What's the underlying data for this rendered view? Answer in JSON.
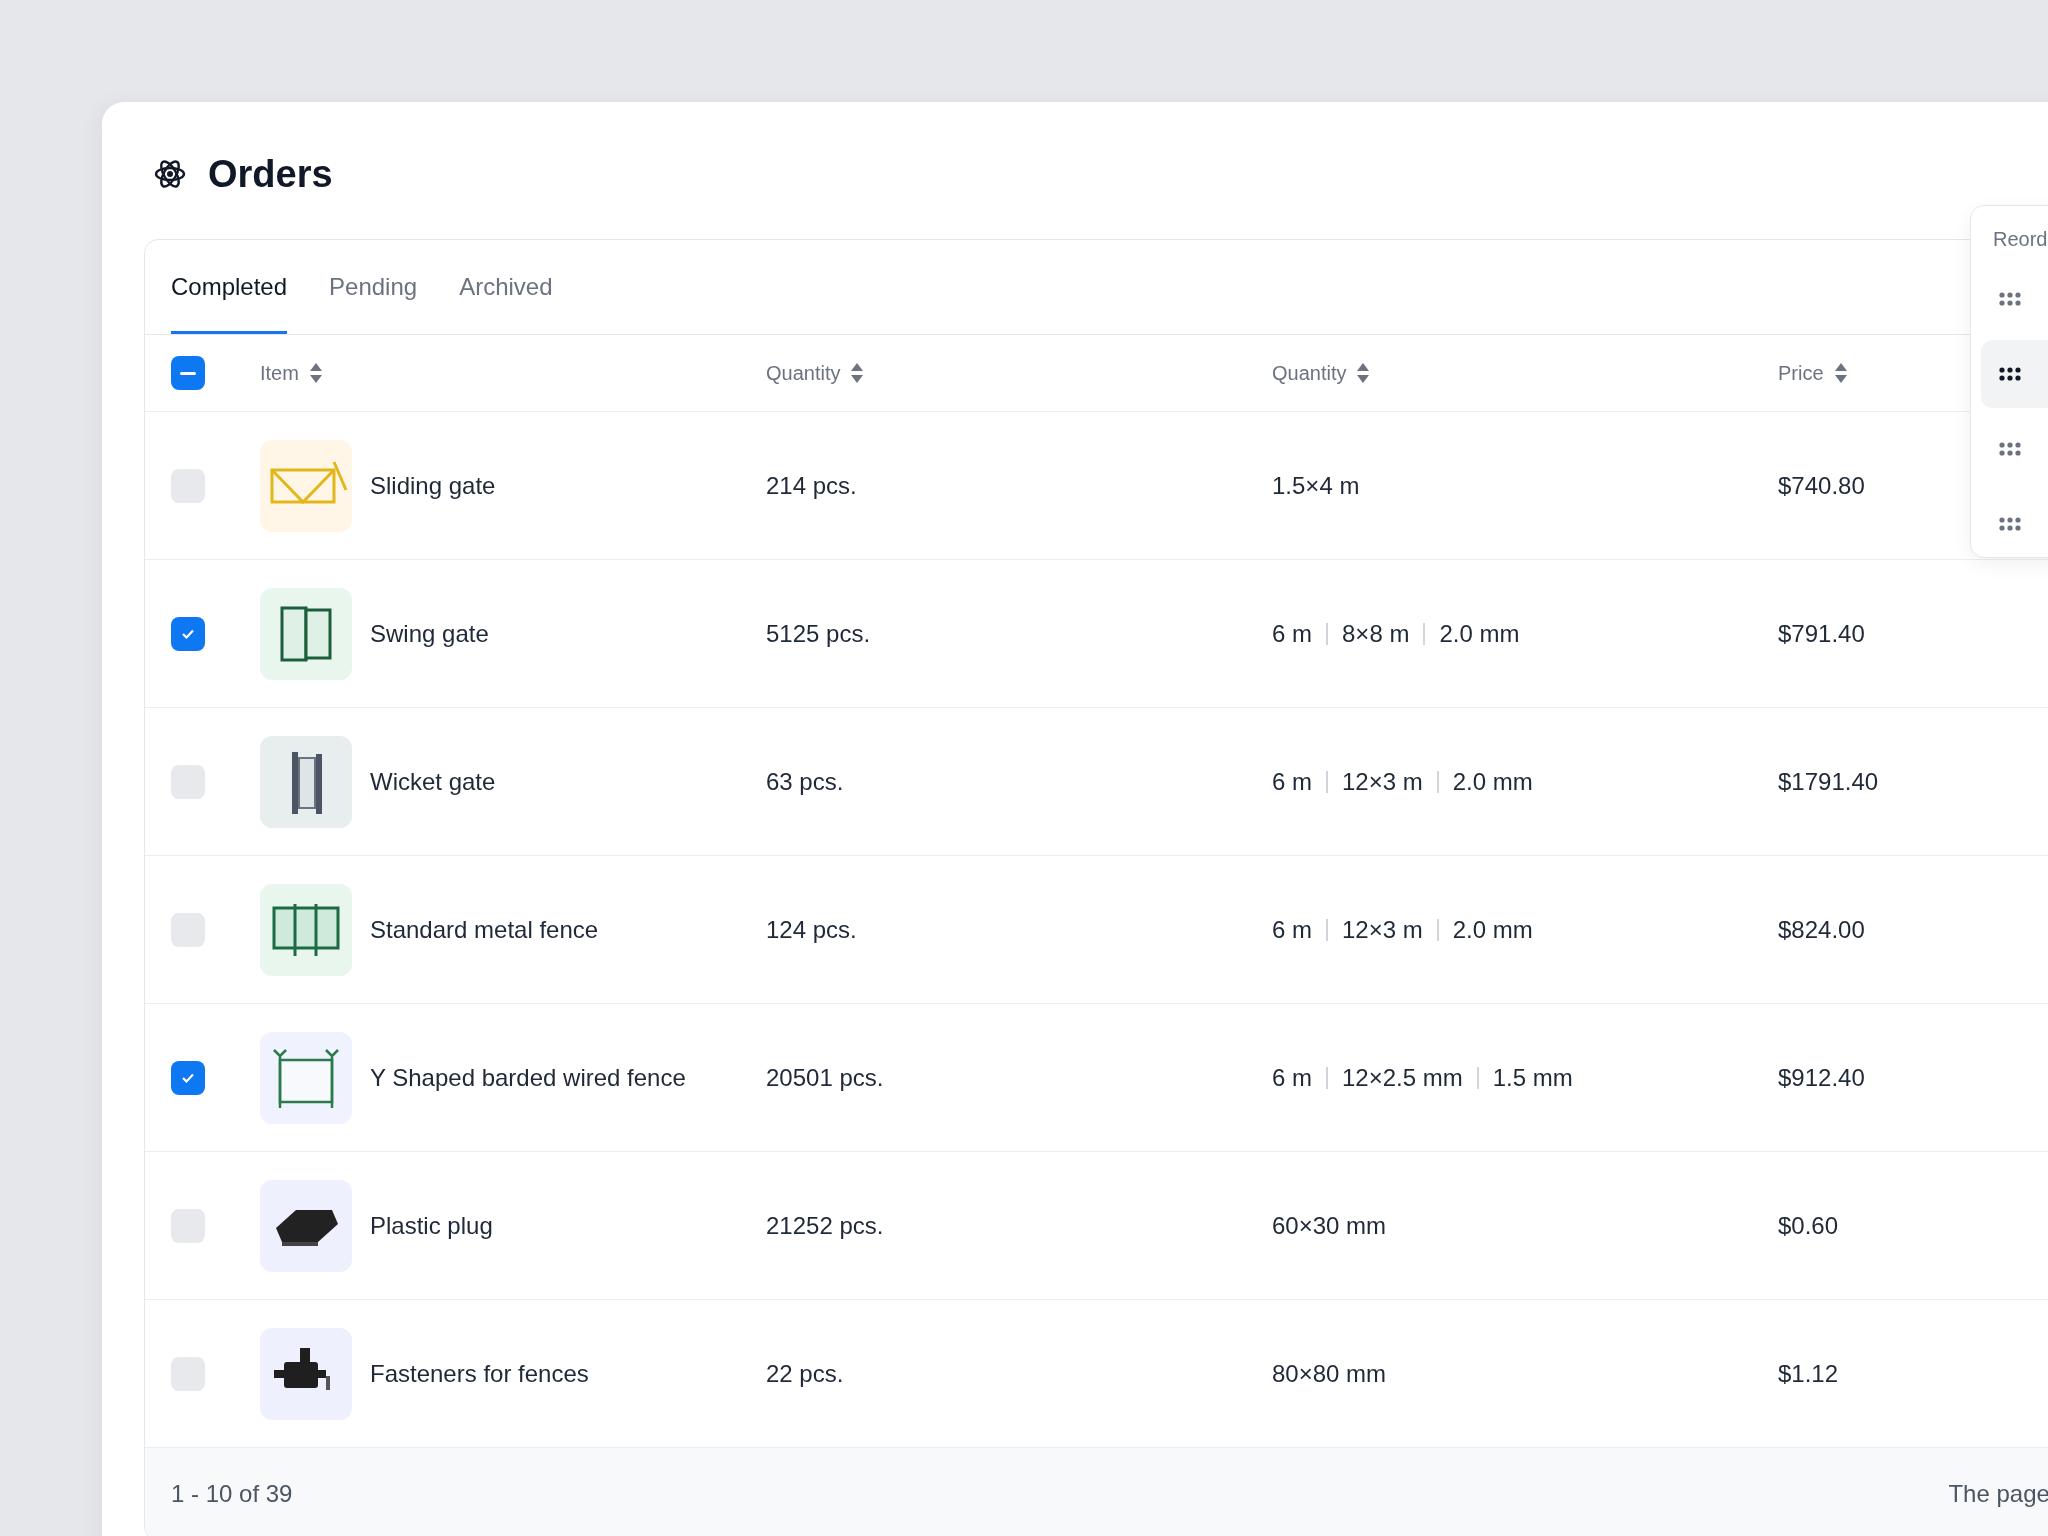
{
  "page": {
    "title": "Orders"
  },
  "tabs": [
    {
      "label": "Completed",
      "selected": true
    },
    {
      "label": "Pending",
      "selected": false
    },
    {
      "label": "Archived",
      "selected": false
    }
  ],
  "table": {
    "select_all": {
      "checked": true,
      "indeterminate": true
    },
    "columns": [
      {
        "label": "Item"
      },
      {
        "label": "Quantity"
      },
      {
        "label": "Quantity"
      },
      {
        "label": "Price"
      }
    ],
    "rows": [
      {
        "checked": false,
        "item": "Sliding gate",
        "quantity": "214 pcs.",
        "size": [
          "1.5×4 m"
        ],
        "price": "$740.80"
      },
      {
        "checked": true,
        "item": "Swing gate",
        "quantity": "5125 pcs.",
        "size": [
          "6 m",
          "8×8 m",
          "2.0 mm"
        ],
        "price": "$791.40"
      },
      {
        "checked": false,
        "item": "Wicket gate",
        "quantity": "63 pcs.",
        "size": [
          "6 m",
          "12×3 m",
          "2.0 mm"
        ],
        "price": "$1791.40"
      },
      {
        "checked": false,
        "item": "Standard metal fence",
        "quantity": "124 pcs.",
        "size": [
          "6 m",
          "12×3 m",
          "2.0 mm"
        ],
        "price": "$824.00"
      },
      {
        "checked": true,
        "item": "Y Shaped barded wired fence",
        "quantity": "20501 pcs.",
        "size": [
          "6 m",
          "12×2.5 mm",
          "1.5 mm"
        ],
        "price": "$912.40"
      },
      {
        "checked": false,
        "item": "Plastic plug",
        "quantity": "21252 pcs.",
        "size": [
          "60×30 mm"
        ],
        "price": "$0.60"
      },
      {
        "checked": false,
        "item": "Fasteners for fences",
        "quantity": "22 pcs.",
        "size": [
          "80×80 mm"
        ],
        "price": "$1.12"
      }
    ]
  },
  "footer": {
    "range": "1 - 10 of 39",
    "right_text": "The page"
  },
  "reorder_menu": {
    "title": "Reord",
    "items": [
      {
        "selected": false
      },
      {
        "selected": true
      },
      {
        "selected": false
      },
      {
        "selected": false
      }
    ]
  }
}
